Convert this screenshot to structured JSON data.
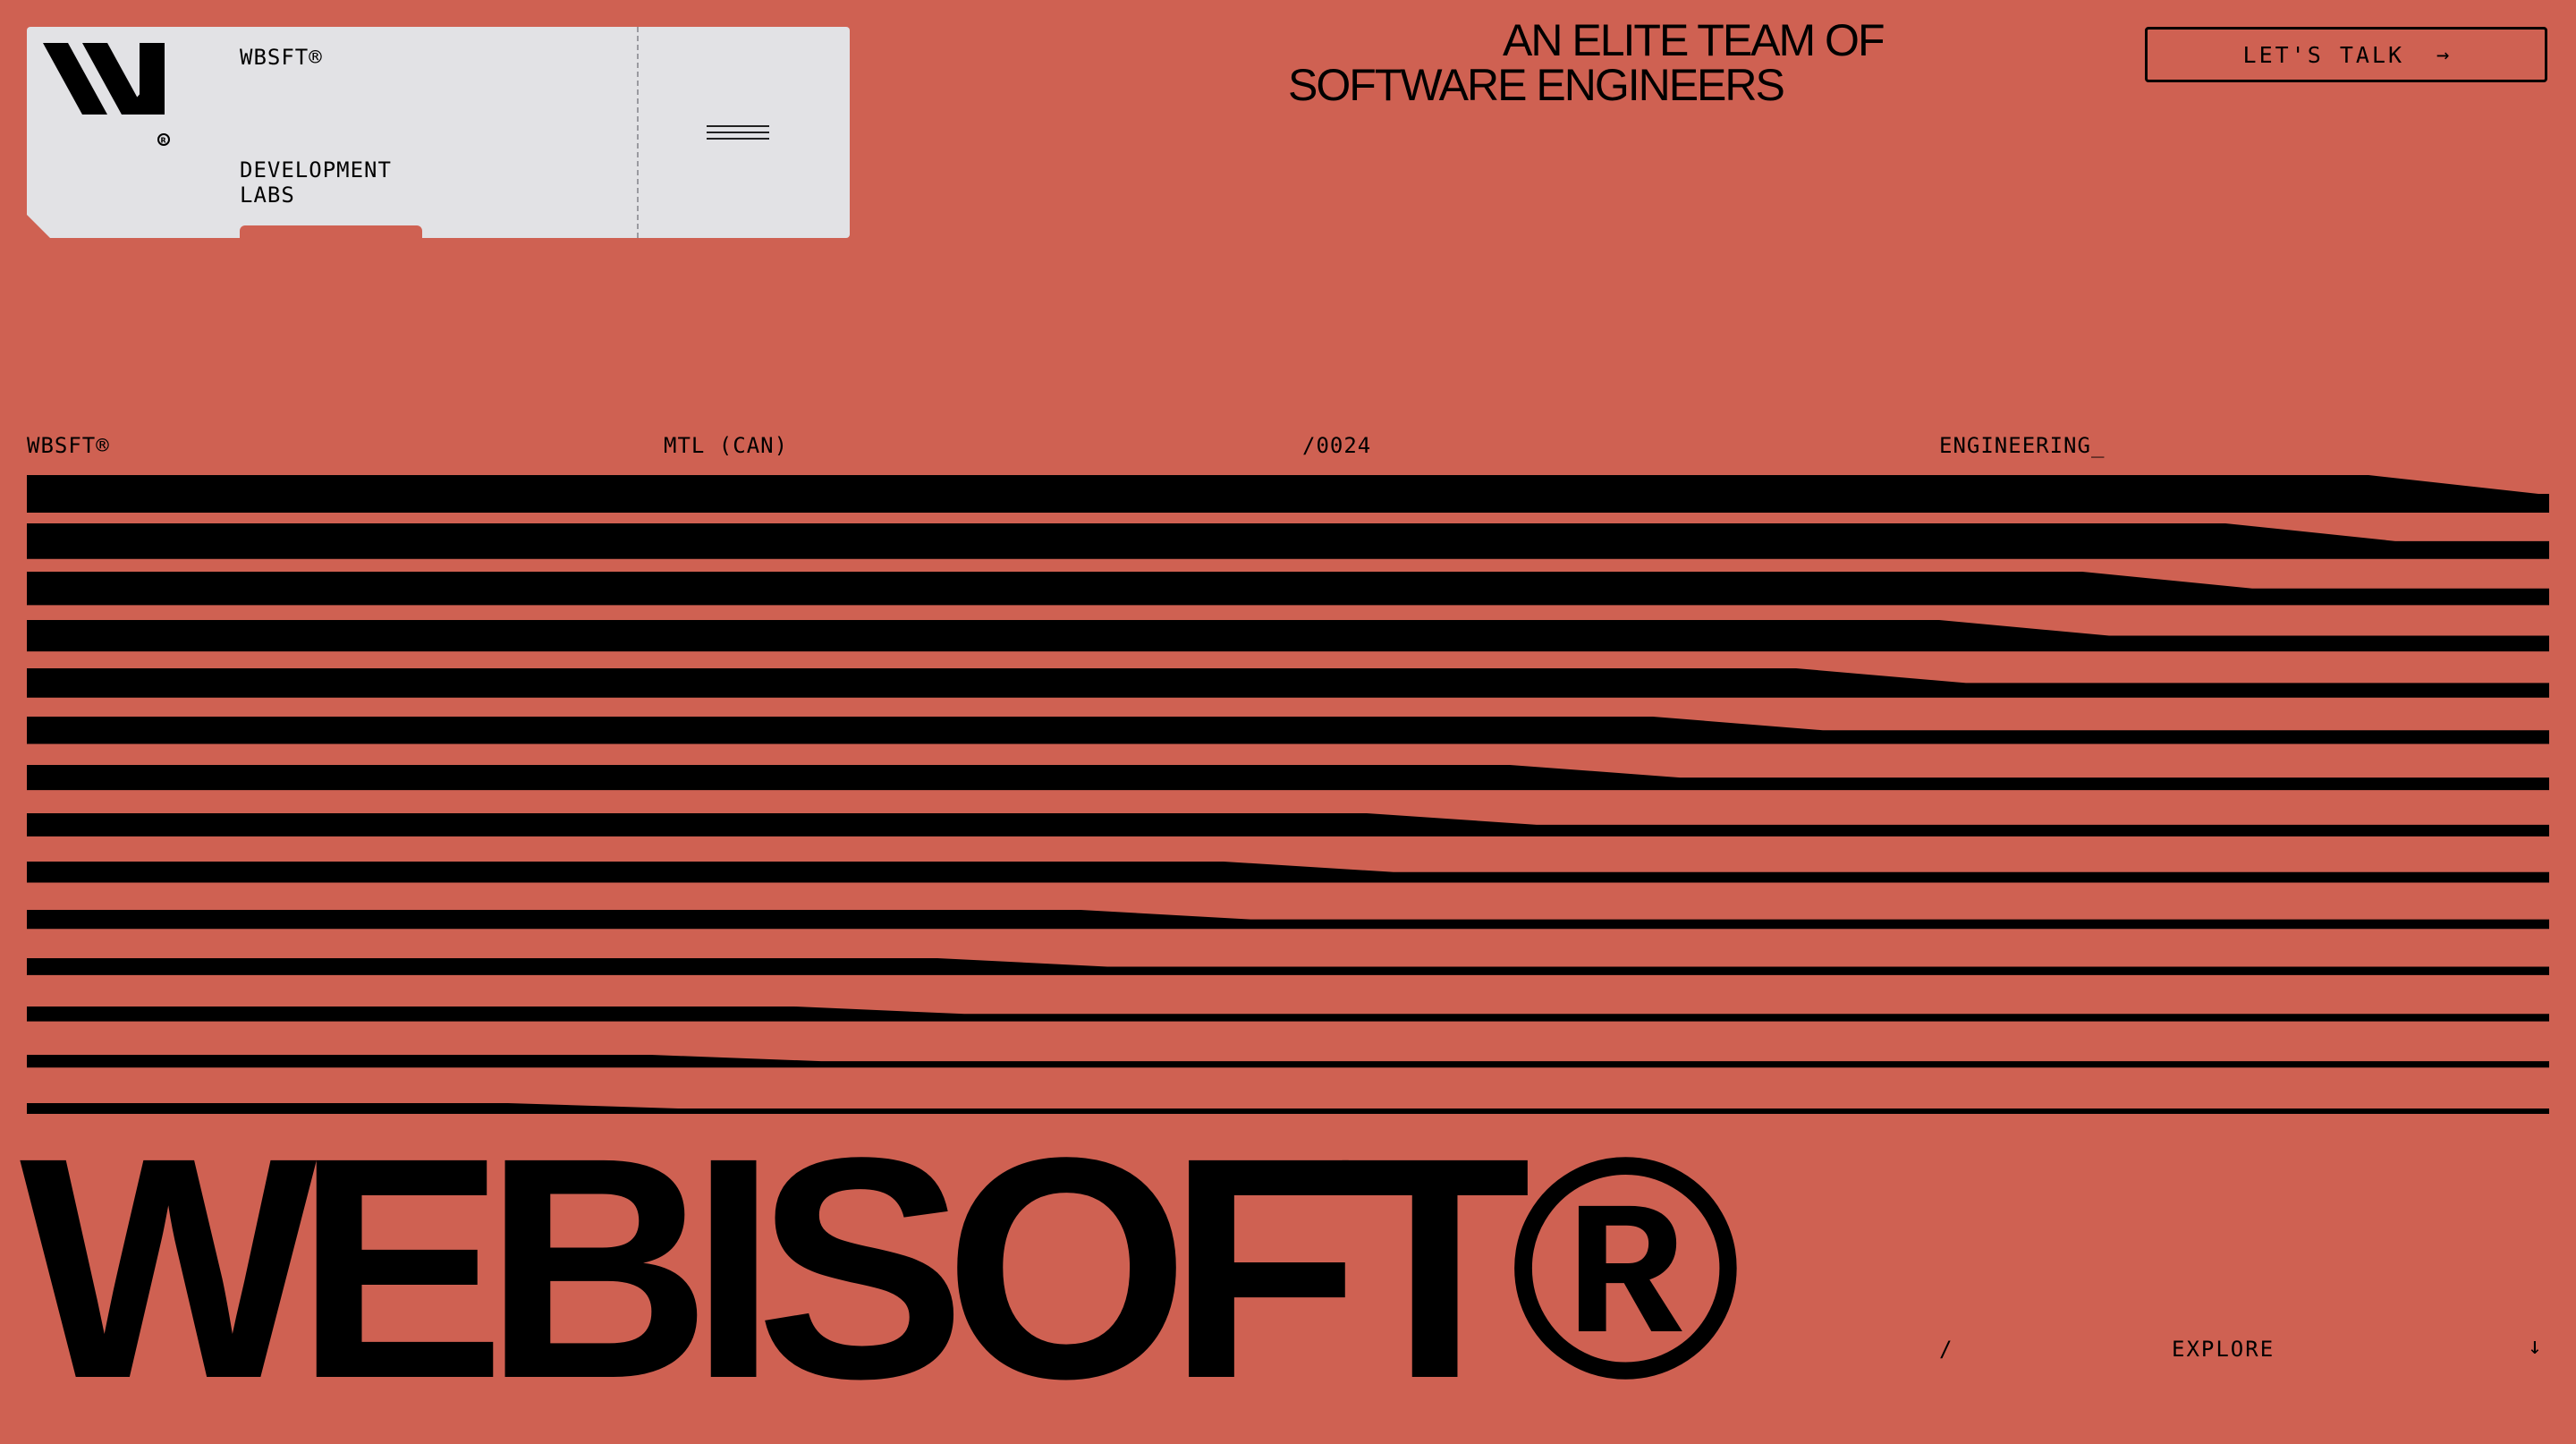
{
  "nav_card": {
    "brand_name": "WBSFT®",
    "tagline": "DEVELOPMENT LABS",
    "logo_icon": "webisoft-logo-icon",
    "menu_icon": "hamburger-menu-icon"
  },
  "headline": {
    "line1": "AN ELITE TEAM OF",
    "line2": "SOFTWARE ENGINEERS"
  },
  "cta": {
    "label": "LET'S TALK",
    "arrow": "→",
    "icon": "arrow-right-icon"
  },
  "meta_row": {
    "brand": "WBSFT®",
    "location": "MTL (CAN)",
    "number": "/0024",
    "discipline": "ENGINEERING_"
  },
  "wordmark": "WEBISOFT®",
  "footer": {
    "slash": "/",
    "explore_label": "EXPLORE",
    "explore_arrow": "↓",
    "icon": "arrow-down-icon"
  },
  "colors": {
    "background": "#cf6152",
    "card": "#e2e2e5",
    "ink": "#000000"
  }
}
